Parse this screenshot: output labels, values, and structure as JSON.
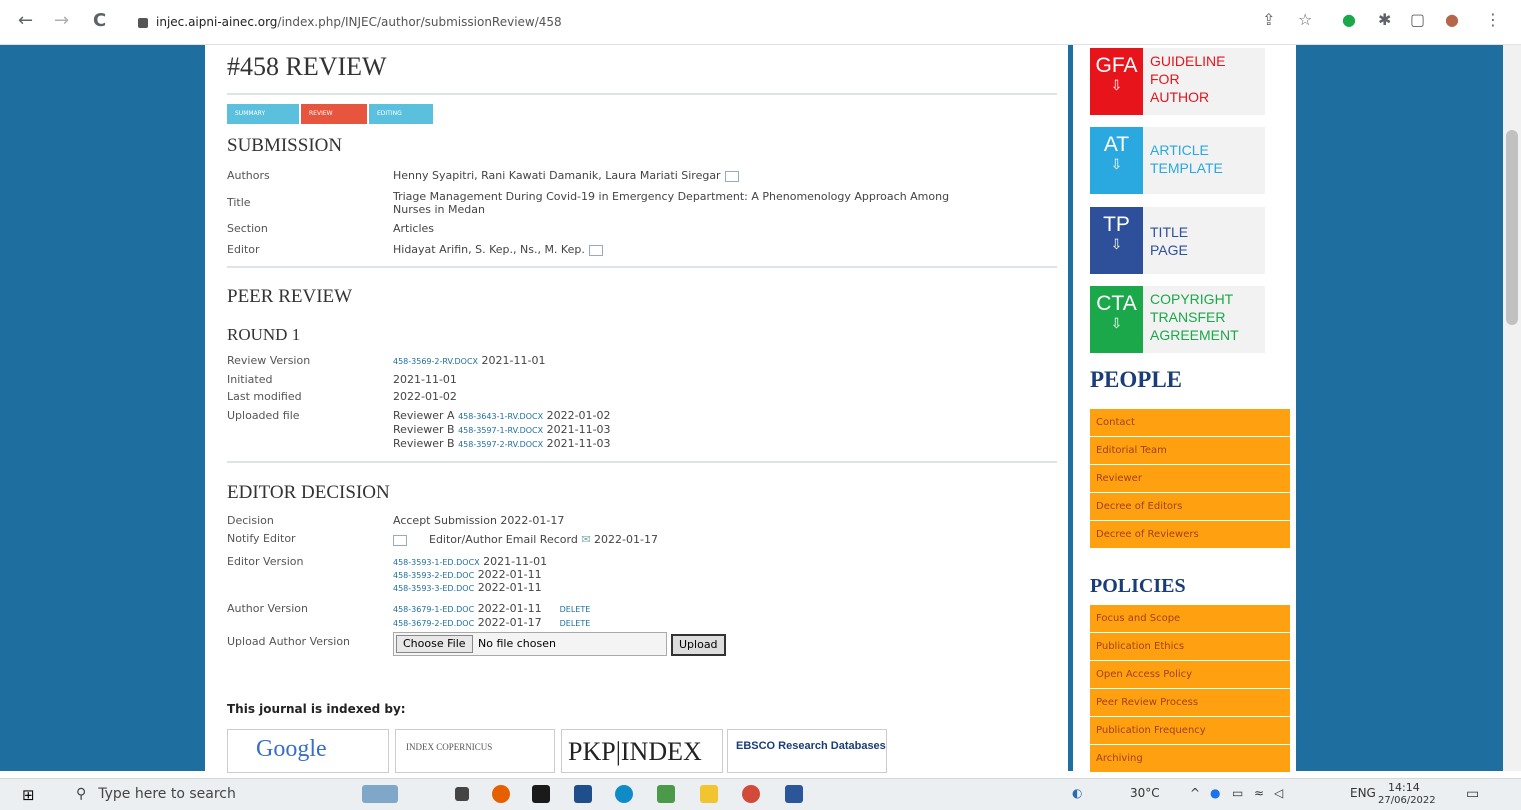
{
  "browser": {
    "url_domain": "injec.aipni-ainec.org",
    "url_path": "/index.php/INJEC/author/submissionReview/458",
    "back": "←",
    "forward": "→",
    "reload": "C"
  },
  "page": {
    "title": "#458 REVIEW",
    "tabs": [
      {
        "label": "Summary"
      },
      {
        "label": "Review"
      },
      {
        "label": "Editing"
      }
    ],
    "submission": {
      "heading": "SUBMISSION",
      "authors_label": "Authors",
      "authors": "Henny Syapitri, Rani Kawati Damanik, Laura Mariati Siregar",
      "title_label": "Title",
      "title_line1": "Triage Management During Covid-19 in Emergency Department: A Phenomenology Approach Among",
      "title_line2": "Nurses in Medan",
      "section_label": "Section",
      "section": "Articles",
      "editor_label": "Editor",
      "editor": "Hidayat Arifin, S. Kep., Ns., M. Kep."
    },
    "peer_review": {
      "heading": "PEER REVIEW",
      "round": "ROUND 1",
      "review_version_label": "Review Version",
      "review_version_file": "458-3569-2-RV.DOCX",
      "review_version_date": "2021-11-01",
      "initiated_label": "Initiated",
      "initiated": "2021-11-01",
      "last_modified_label": "Last modified",
      "last_modified": "2022-01-02",
      "uploaded_label": "Uploaded file",
      "uploads": [
        {
          "reviewer": "Reviewer A",
          "file": "458-3643-1-RV.DOCX",
          "date": "2022-01-02"
        },
        {
          "reviewer": "Reviewer B",
          "file": "458-3597-1-RV.DOCX",
          "date": "2021-11-03"
        },
        {
          "reviewer": "Reviewer B",
          "file": "458-3597-2-RV.DOCX",
          "date": "2021-11-03"
        }
      ]
    },
    "editor_decision": {
      "heading": "EDITOR DECISION",
      "decision_label": "Decision",
      "decision": "Accept Submission 2022-01-17",
      "notify_label": "Notify Editor",
      "notify_record": "Editor/Author Email Record",
      "notify_date": "2022-01-17",
      "editor_version_label": "Editor Version",
      "editor_versions": [
        {
          "file": "458-3593-1-ED.DOCX",
          "date": "2021-11-01"
        },
        {
          "file": "458-3593-2-ED.DOC",
          "date": "2022-01-11"
        },
        {
          "file": "458-3593-3-ED.DOC",
          "date": "2022-01-11"
        }
      ],
      "author_version_label": "Author Version",
      "author_versions": [
        {
          "file": "458-3679-1-ED.DOC",
          "date": "2022-01-11",
          "action": "DELETE"
        },
        {
          "file": "458-3679-2-ED.DOC",
          "date": "2022-01-17",
          "action": "DELETE"
        }
      ],
      "upload_label": "Upload Author Version",
      "choose_file": "Choose File",
      "no_file": "No file chosen",
      "upload_button": "Upload"
    },
    "indexed_by": "This journal is indexed by:",
    "index_logos": [
      "Google",
      "INDEX COPERNICUS",
      "PKP|INDEX",
      "EBSCO Research Databases"
    ]
  },
  "sidebar": {
    "downloads": [
      {
        "abbr": "GFA",
        "lines": [
          "GUIDELINE",
          "FOR",
          "AUTHOR"
        ],
        "tile_color": "#e8141c",
        "text_color": "#e8141c"
      },
      {
        "abbr": "AT",
        "lines": [
          "ARTICLE",
          "TEMPLATE"
        ],
        "tile_color": "#2aa8e0",
        "text_color": "#2aa8e0"
      },
      {
        "abbr": "TP",
        "lines": [
          "TITLE",
          "PAGE"
        ],
        "tile_color": "#2e4f9a",
        "text_color": "#2e4f9a"
      },
      {
        "abbr": "CTA",
        "lines": [
          "COPYRIGHT",
          "TRANSFER",
          "AGREEMENT"
        ],
        "tile_color": "#1aa84a",
        "text_color": "#1aa84a"
      }
    ],
    "people_heading": "PEOPLE",
    "people": [
      "Contact",
      "Editorial Team",
      "Reviewer",
      "Decree of Editors",
      "Decree of Reviewers"
    ],
    "policies_heading": "POLICIES",
    "policies": [
      "Focus and Scope",
      "Publication Ethics",
      "Open Access Policy",
      "Peer Review Process",
      "Publication Frequency",
      "Archiving"
    ]
  },
  "taskbar": {
    "search_placeholder": "Type here to search",
    "weather": "30°C",
    "lang": "ENG",
    "time": "14:14",
    "date": "27/06/2022"
  }
}
